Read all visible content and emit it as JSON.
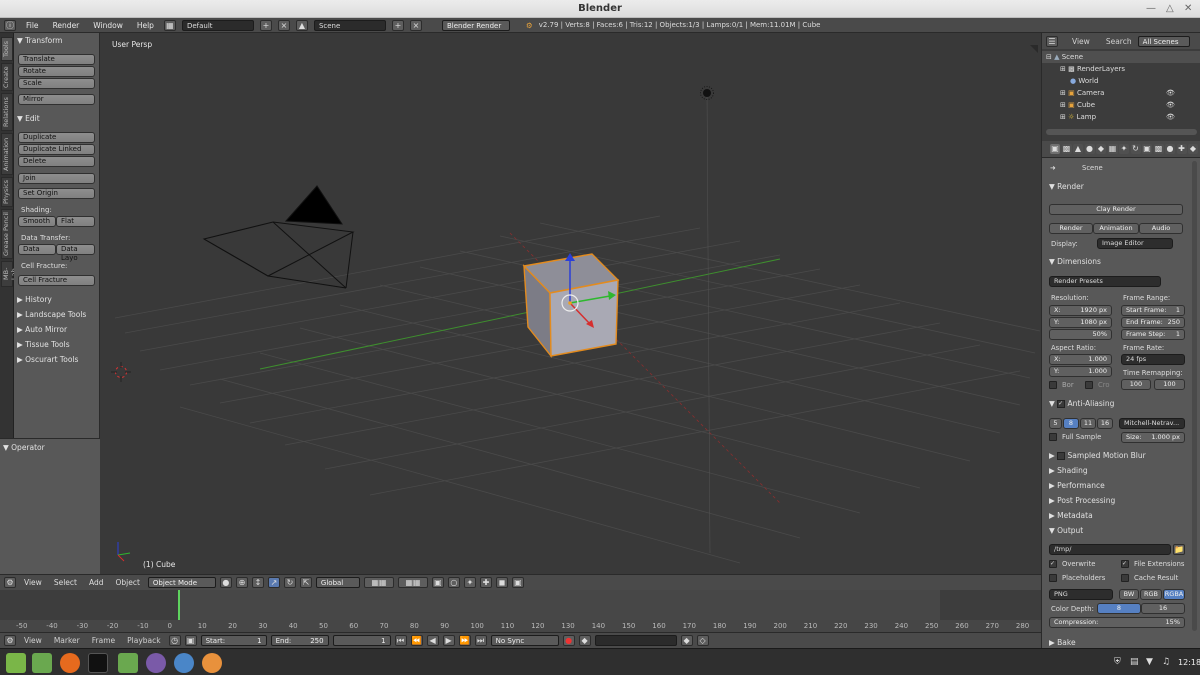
{
  "window": {
    "title": "Blender"
  },
  "info": {
    "menus": [
      "File",
      "Render",
      "Window",
      "Help"
    ],
    "layout": "Default",
    "scene": "Scene",
    "engine": "Blender Render",
    "stats": "v2.79 | Verts:8 | Faces:6 | Tris:12 | Objects:1/3 | Lamps:0/1 | Mem:11.01M | Cube"
  },
  "tabs": [
    "Tools",
    "Create",
    "Relations",
    "Animation",
    "Physics",
    "Grease Pencil",
    "MB-Lab"
  ],
  "tools": {
    "transform": "Transform",
    "translate": "Translate",
    "rotate": "Rotate",
    "scale": "Scale",
    "mirror": "Mirror",
    "edit": "Edit",
    "duplicate": "Duplicate",
    "duplicate_linked": "Duplicate Linked",
    "delete": "Delete",
    "join": "Join",
    "set_origin": "Set Origin",
    "shading": "Shading:",
    "smooth": "Smooth",
    "flat": "Flat",
    "data_transfer": "Data Transfer:",
    "data": "Data",
    "data_layo": "Data Layo",
    "cell_fracture_label": "Cell Fracture:",
    "cell_fracture": "Cell Fracture",
    "collapsed": [
      "History",
      "Landscape Tools",
      "Auto Mirror",
      "Tissue Tools",
      "Oscurart Tools"
    ]
  },
  "operator": "Operator",
  "viewport": {
    "view_name": "User Persp",
    "object": "(1) Cube"
  },
  "vp_header": {
    "view": "View",
    "select": "Select",
    "add": "Add",
    "object": "Object",
    "mode": "Object Mode",
    "orientation": "Global"
  },
  "timeline": {
    "ticks": [
      "-50",
      "-40",
      "-30",
      "-20",
      "-10",
      "0",
      "10",
      "20",
      "30",
      "40",
      "50",
      "60",
      "70",
      "80",
      "90",
      "100",
      "110",
      "120",
      "130",
      "140",
      "150",
      "160",
      "170",
      "180",
      "190",
      "200",
      "210",
      "220",
      "230",
      "240",
      "250",
      "260",
      "270",
      "280"
    ],
    "menus": [
      "View",
      "Marker",
      "Frame",
      "Playback"
    ],
    "start": "Start:",
    "start_val": "1",
    "end": "End:",
    "end_val": "250",
    "current": "1",
    "sync": "No Sync"
  },
  "outliner": {
    "view": "View",
    "search": "Search",
    "all_scenes": "All Scenes",
    "items": [
      "Scene",
      "RenderLayers",
      "World",
      "Camera",
      "Cube",
      "Lamp"
    ]
  },
  "props": {
    "scene": "Scene",
    "render": "Render",
    "clay": "Clay Render",
    "render_btn": "Render",
    "animation_btn": "Animation",
    "audio_btn": "Audio",
    "display": "Display:",
    "display_val": "Image Editor",
    "dimensions": "Dimensions",
    "render_presets": "Render Presets",
    "resolution": "Resolution:",
    "res_x": "X:",
    "res_x_val": "1920 px",
    "res_y": "Y:",
    "res_y_val": "1080 px",
    "res_pct": "50%",
    "frame_range": "Frame Range:",
    "start_frame": "Start Frame:",
    "start_frame_val": "1",
    "end_frame": "End Frame:",
    "end_frame_val": "250",
    "frame_step": "Frame Step:",
    "frame_step_val": "1",
    "aspect": "Aspect Ratio:",
    "asp_x": "X:",
    "asp_x_val": "1.000",
    "asp_y": "Y:",
    "asp_y_val": "1.000",
    "frame_rate": "Frame Rate:",
    "fps": "24 fps",
    "time_remap": "Time Remapping:",
    "remap_a": "100",
    "remap_b": "100",
    "bor": "Bor",
    "cro": "Cro",
    "aa": "Anti-Aliasing",
    "aa_samples": [
      "5",
      "8",
      "11",
      "16"
    ],
    "aa_filter": "Mitchell-Netrav...",
    "full_sample": "Full Sample",
    "size": "Size:",
    "size_val": "1.000 px",
    "motion_blur": "Sampled Motion Blur",
    "shading": "Shading",
    "performance": "Performance",
    "post": "Post Processing",
    "metadata": "Metadata",
    "output": "Output",
    "output_path": "/tmp/",
    "overwrite": "Overwrite",
    "file_ext": "File Extensions",
    "placeholders": "Placeholders",
    "cache": "Cache Result",
    "format": "PNG",
    "bw": "BW",
    "rgb": "RGB",
    "rgba": "RGBA",
    "color_depth": "Color Depth:",
    "depth8": "8",
    "depth16": "16",
    "compression": "Compression:",
    "compression_val": "15%",
    "bake": "Bake"
  },
  "taskbar": {
    "time": "12:18"
  }
}
